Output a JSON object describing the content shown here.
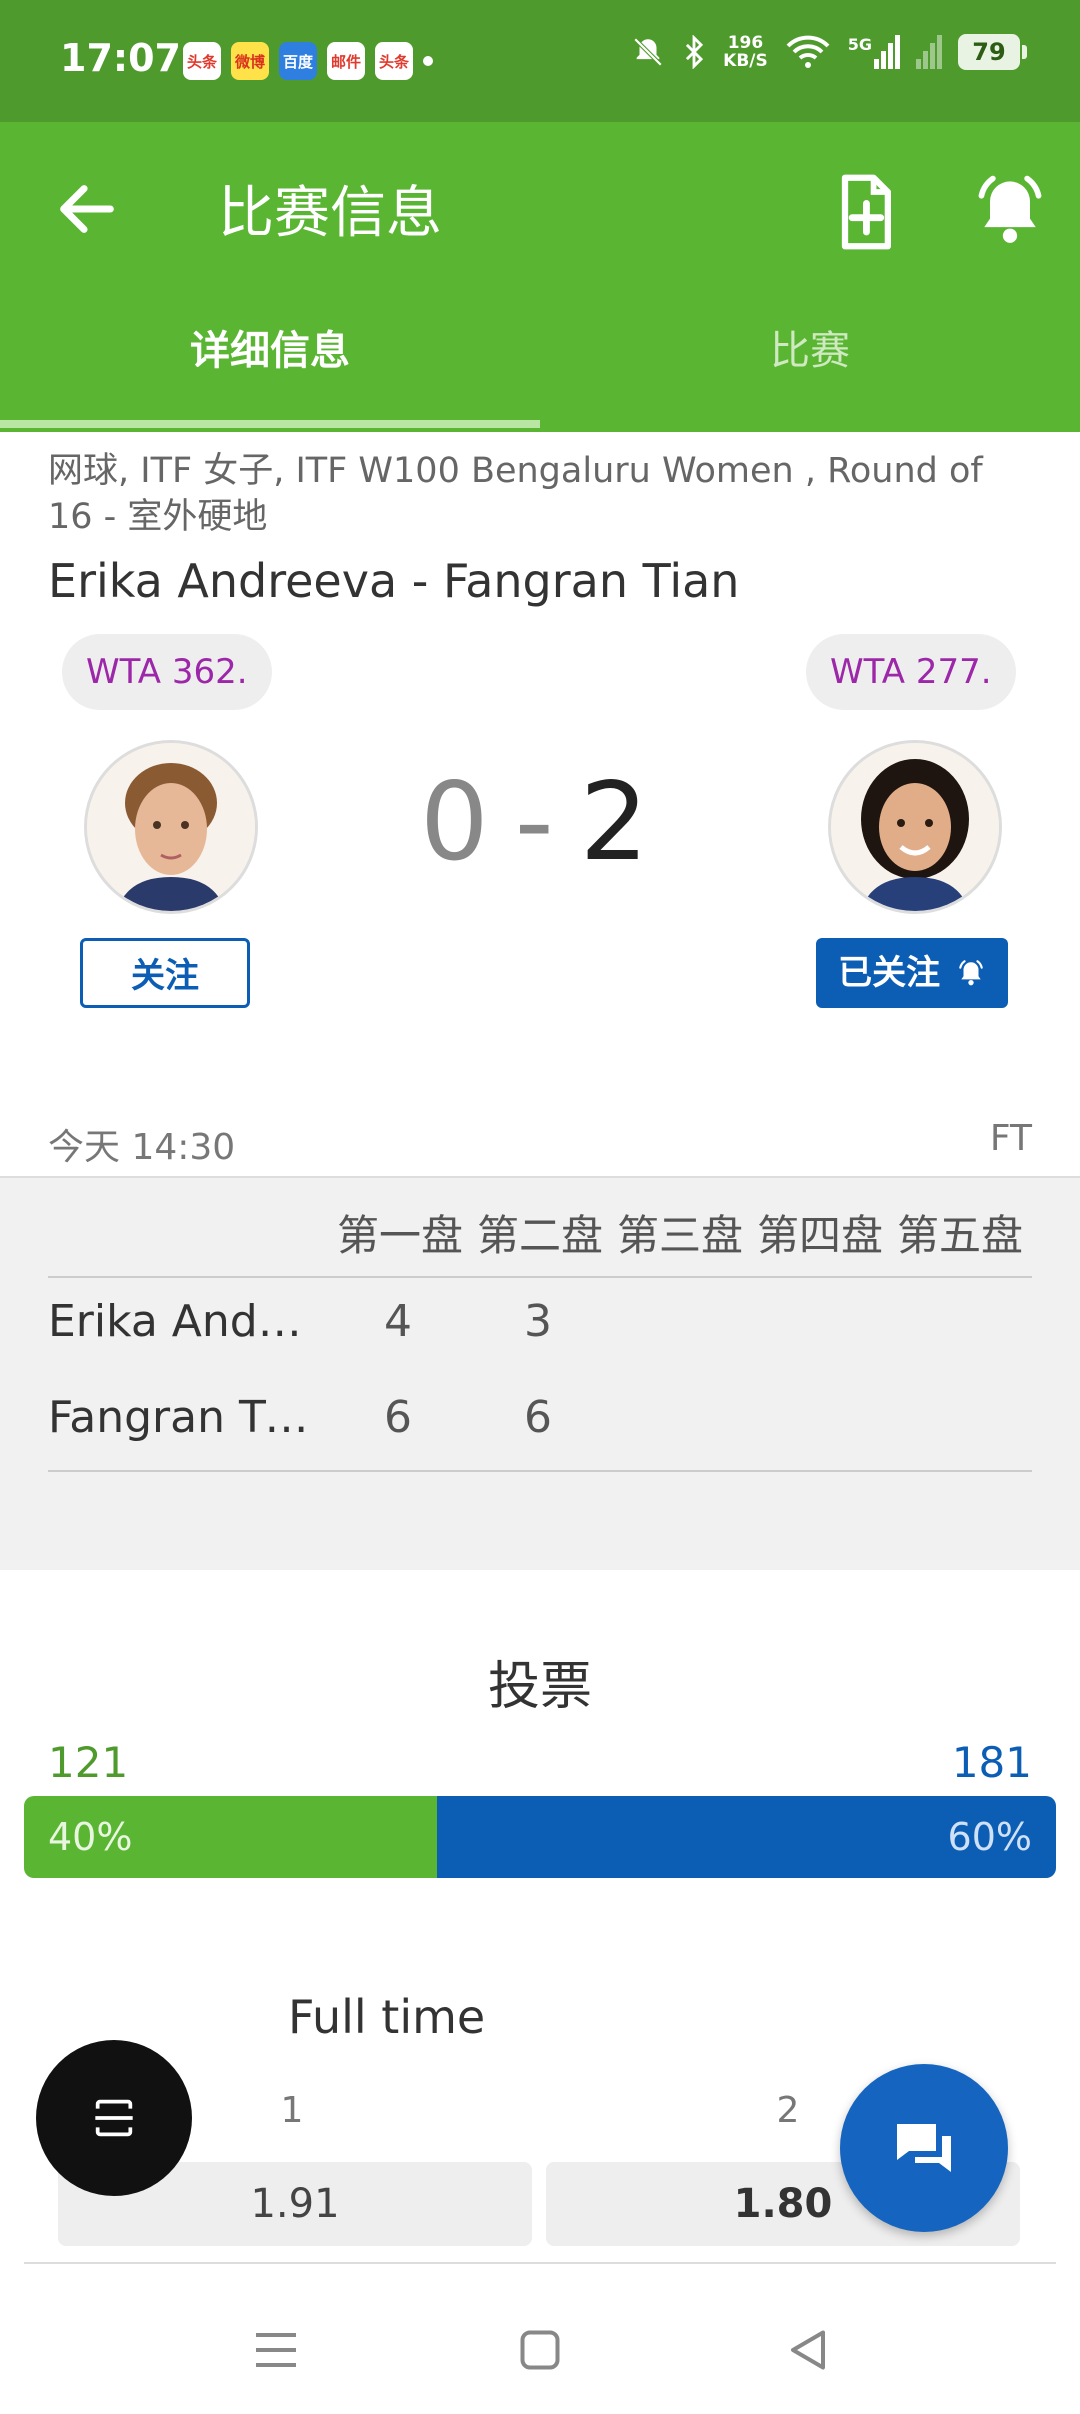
{
  "status_bar": {
    "time": "17:07",
    "app_icons": [
      "头条",
      "微博",
      "百度",
      "邮件",
      "头条"
    ],
    "net_speed_value": "196",
    "net_speed_unit": "KB/S",
    "network": "5G",
    "battery": "79"
  },
  "app_bar": {
    "title": "比赛信息",
    "tabs": [
      {
        "label": "详细信息",
        "active": true
      },
      {
        "label": "比赛",
        "active": false
      }
    ]
  },
  "match": {
    "tournament": "网球, ITF 女子, ITF W100 Bengaluru Women , Round of 16 - 室外硬地",
    "matchup": "Erika Andreeva - Fangran Tian",
    "home": {
      "rank": "WTA 362.",
      "follow_label": "关注"
    },
    "away": {
      "rank": "WTA 277.",
      "follow_label": "已关注"
    },
    "score_home": "0",
    "score_separator": "-",
    "score_away": "2",
    "datetime": "今天 14:30",
    "status": "FT"
  },
  "sets": {
    "headers": [
      "第一盘",
      "第二盘",
      "第三盘",
      "第四盘",
      "第五盘"
    ],
    "rows": [
      {
        "name": "Erika Andreeva",
        "scores": [
          "4",
          "3"
        ]
      },
      {
        "name": "Fangran Tian",
        "scores": [
          "6",
          "6"
        ]
      }
    ]
  },
  "vote": {
    "title": "投票",
    "home_count": "121",
    "away_count": "181",
    "home_pct_label": "40%",
    "away_pct_label": "60%",
    "home_fraction": 0.4,
    "home_color": "#5ab533",
    "away_color": "#0c5eb5"
  },
  "odds": {
    "title": "Full time",
    "labels": [
      "1",
      "2"
    ],
    "values": [
      "1.91",
      "1.80"
    ]
  },
  "colors": {
    "primary_green": "#5ab533",
    "accent_blue": "#0c5eb5"
  }
}
